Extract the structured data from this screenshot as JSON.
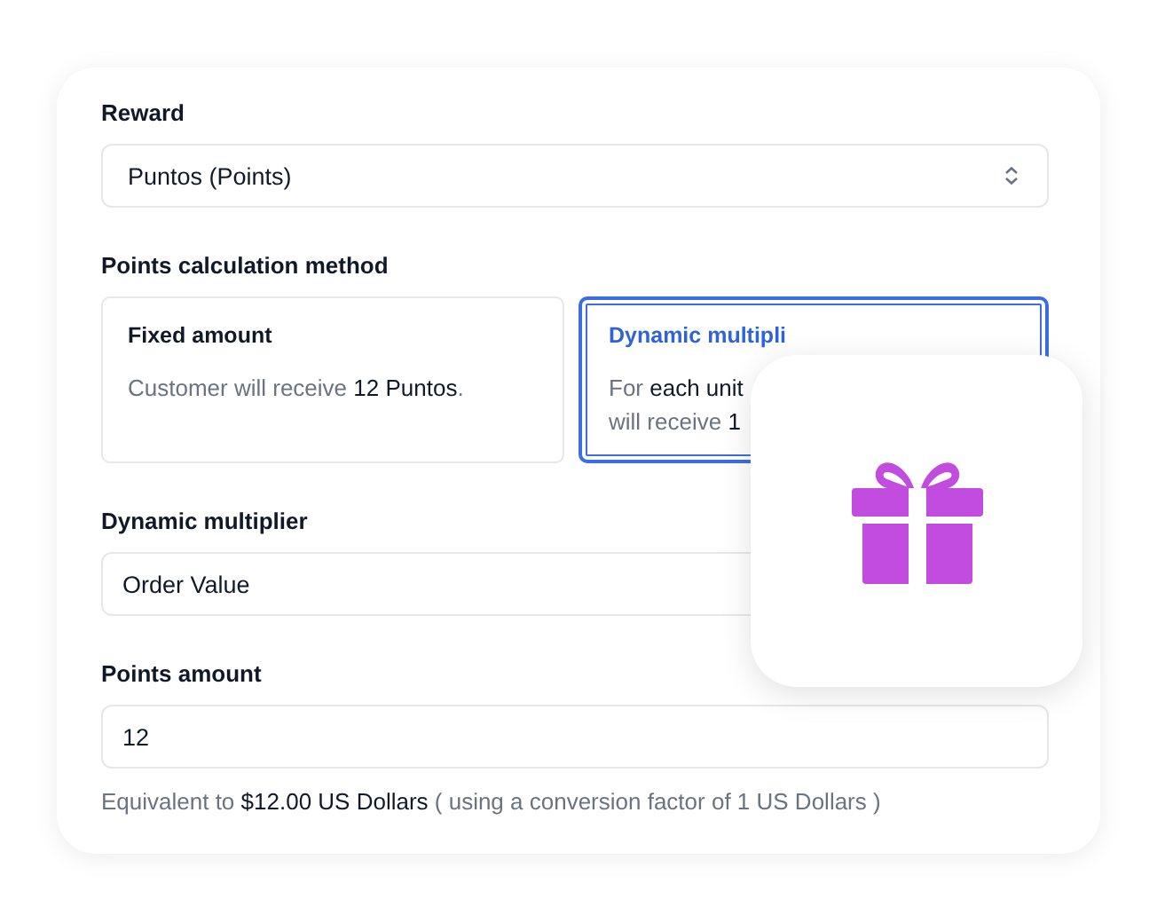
{
  "reward": {
    "label": "Reward",
    "value": "Puntos (Points)"
  },
  "calculation": {
    "label": "Points calculation method",
    "options": [
      {
        "title": "Fixed amount",
        "lines": [
          "Customer will receive **12 Puntos**."
        ],
        "selected": false
      },
      {
        "title": "Dynamic multipli",
        "lines": [
          "For **each unit**",
          "will receive **1**"
        ],
        "selected": true
      }
    ]
  },
  "multiplier": {
    "label": "Dynamic multiplier",
    "value": "Order Value"
  },
  "points": {
    "label": "Points amount",
    "value": "12",
    "help": "Equivalent to **$12.00 US Dollars** ( using a conversion factor of 1 US Dollars )"
  }
}
